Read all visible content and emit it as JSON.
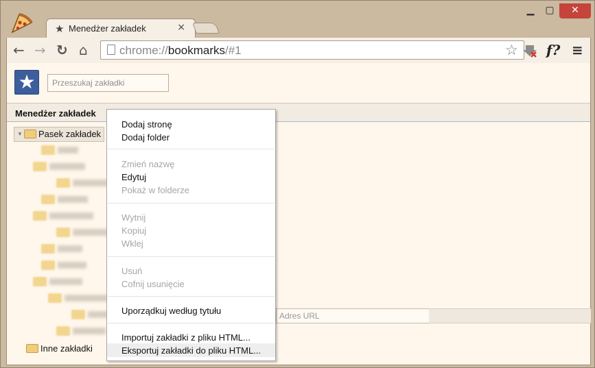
{
  "window": {
    "controls": {
      "minimize": "▁",
      "maximize": "▢",
      "close": "✕"
    }
  },
  "tab": {
    "title": "Menedżer zakładek",
    "icon": "star-icon",
    "close": "×"
  },
  "toolbar": {
    "back": "←",
    "forward": "→",
    "reload": "↻",
    "home": "⌂",
    "url_scheme": "chrome://",
    "url_host": "bookmarks",
    "url_path": "/#1",
    "star": "☆",
    "ext_label": "f?",
    "menu": "≡"
  },
  "page": {
    "logo": "★",
    "search_placeholder": "Przeszukaj zakładki",
    "header_label": "Menedżer zakładek",
    "tree": {
      "bookmarks_bar": "Pasek zakładek",
      "other_bookmarks": "Inne zakładki"
    },
    "url_placeholder": "Adres URL"
  },
  "context_menu": {
    "items": [
      {
        "label": "Dodaj stronę",
        "enabled": true
      },
      {
        "label": "Dodaj folder",
        "enabled": true
      },
      {
        "label": "Zmień nazwę",
        "enabled": false
      },
      {
        "label": "Edytuj",
        "enabled": true
      },
      {
        "label": "Pokaż w folderze",
        "enabled": false
      },
      {
        "label": "Wytnij",
        "enabled": false
      },
      {
        "label": "Kopiuj",
        "enabled": false
      },
      {
        "label": "Wklej",
        "enabled": false
      },
      {
        "label": "Usuń",
        "enabled": false
      },
      {
        "label": "Cofnij usunięcie",
        "enabled": false
      },
      {
        "label": "Uporządkuj według tytułu",
        "enabled": true
      },
      {
        "label": "Importuj zakładki z pliku HTML...",
        "enabled": true
      },
      {
        "label": "Eksportuj zakładki do pliku HTML...",
        "enabled": true,
        "highlighted": true
      }
    ]
  },
  "colors": {
    "frame": "#cbb9a0",
    "content_bg": "#fff7ec",
    "close_button": "#c5443b",
    "logo_blue": "#3d5e9c"
  }
}
